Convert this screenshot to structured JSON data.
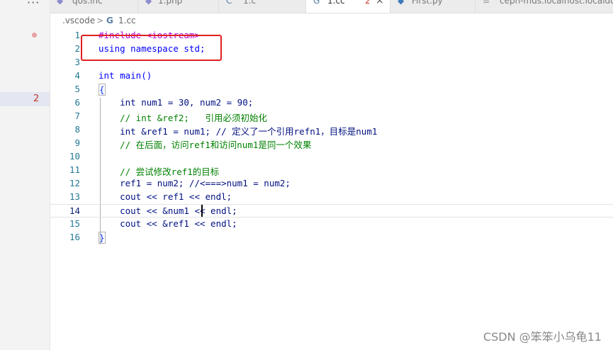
{
  "activity_bar": {
    "more_label": "···",
    "problem_count": "2"
  },
  "tabs": [
    {
      "label": "qos.inc",
      "icon": "php-icon",
      "active": false
    },
    {
      "label": "1.php",
      "icon": "php-icon",
      "active": false
    },
    {
      "label": "1.c",
      "icon": "c-file-icon",
      "active": false
    },
    {
      "label": "1.cc",
      "icon": "cpp-file-icon",
      "active": true,
      "problems": "2"
    },
    {
      "label": "First.py",
      "icon": "python-file-icon",
      "active": false
    },
    {
      "label": "ceph-mds.localhost.localdom",
      "icon": "file-icon",
      "active": false
    }
  ],
  "tab_close_glyph": "×",
  "breadcrumb": {
    "folder": ".vscode",
    "separator": ">",
    "file_icon": "G",
    "file": "1.cc"
  },
  "editor": {
    "current_line": 14,
    "lines": [
      {
        "n": "1",
        "text": "#include <iostream>"
      },
      {
        "n": "2",
        "text": "using namespace std;"
      },
      {
        "n": "3",
        "text": ""
      },
      {
        "n": "4",
        "text": "int main()"
      },
      {
        "n": "5",
        "text": "{"
      },
      {
        "n": "6",
        "text": "    int num1 = 30, num2 = 90;"
      },
      {
        "n": "7",
        "text": "    // int &ref2;   引用必须初始化"
      },
      {
        "n": "8",
        "text": "    int &ref1 = num1; // 定义了一个引用refn1，目标是num1"
      },
      {
        "n": "9",
        "text": "    // 在后面，访问ref1和访问num1是同一个效果"
      },
      {
        "n": "10",
        "text": ""
      },
      {
        "n": "11",
        "text": "    // 尝试修改ref1的目标"
      },
      {
        "n": "12",
        "text": "    ref1 = num2; //<===>num1 = num2;"
      },
      {
        "n": "13",
        "text": "    cout << ref1 << endl;"
      },
      {
        "n": "14",
        "text": "    cout << &num1 << endl;"
      },
      {
        "n": "15",
        "text": "    cout << &ref1 << endl;"
      },
      {
        "n": "16",
        "text": "}"
      }
    ]
  },
  "watermark": "CSDN @笨笨小乌龟11",
  "colors": {
    "keyword": "#0000ff",
    "preprocessor": "#af00db",
    "comment": "#008000",
    "number": "#098658",
    "annotation_box": "#e02020"
  }
}
